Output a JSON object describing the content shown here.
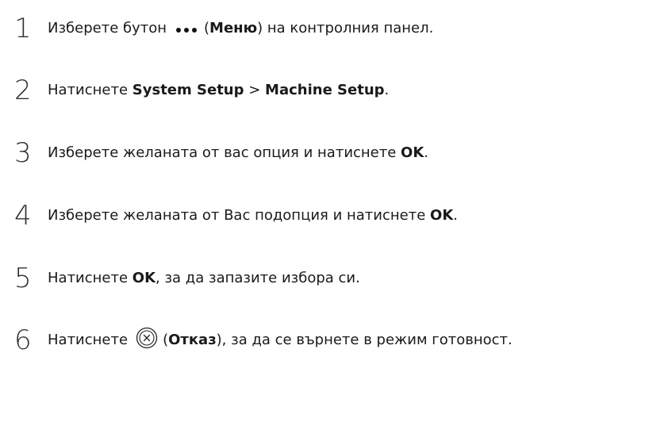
{
  "steps": [
    {
      "number": "1",
      "pre": "Изберете бутон",
      "bold": "Меню",
      "post": ") на контролния панел.",
      "icon": "menu-dots-icon"
    },
    {
      "number": "2",
      "pre": "Натиснете ",
      "bold1": "System Setup",
      "sep": " > ",
      "bold2": "Machine Setup",
      "post": "."
    },
    {
      "number": "3",
      "pre": "Изберете желаната от вас опция и натиснете ",
      "bold": "OK",
      "post": "."
    },
    {
      "number": "4",
      "pre": "Изберете желаната от Вас подопция и натиснете ",
      "bold": "OK",
      "post": "."
    },
    {
      "number": "5",
      "pre": "Натиснете ",
      "bold": "OK",
      "post": ", за да запазите избора си."
    },
    {
      "number": "6",
      "pre": "Натиснете",
      "open_paren": "(",
      "bold": "Отказ",
      "post": "), за да се върнете в режим готовност.",
      "icon": "cancel-icon"
    }
  ]
}
